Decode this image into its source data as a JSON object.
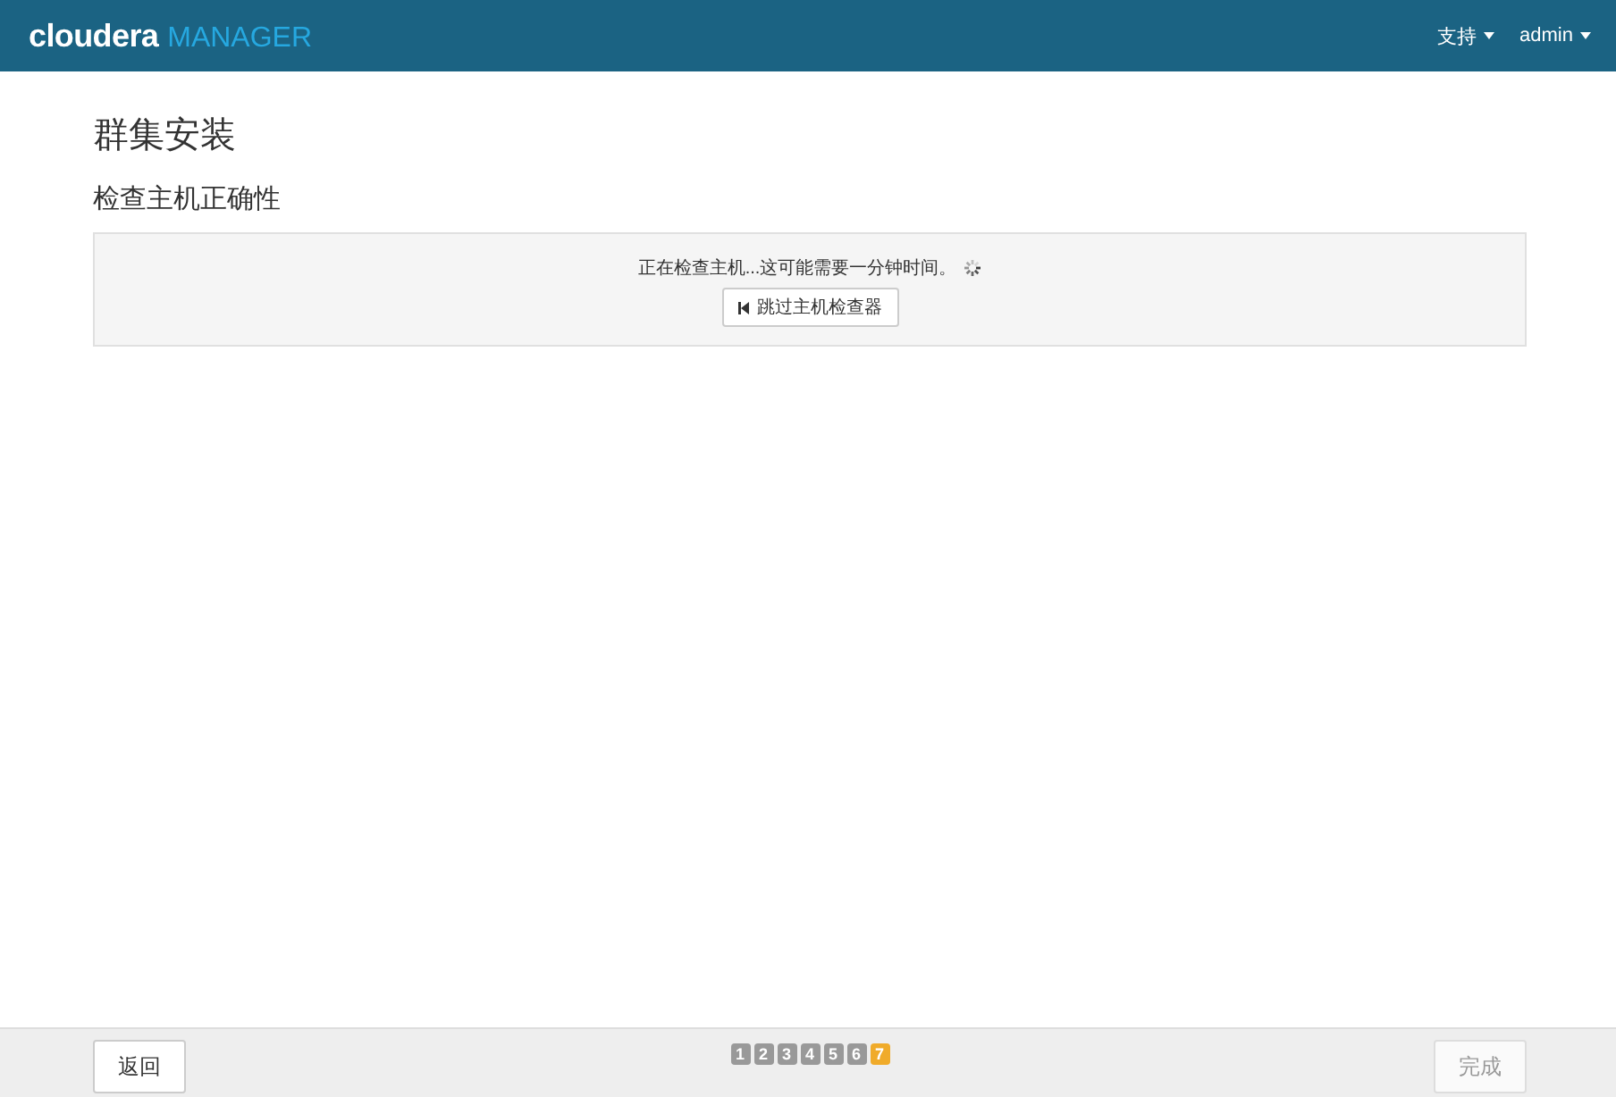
{
  "header": {
    "logo": {
      "brand": "cloudera",
      "product": "MANAGER"
    },
    "menus": [
      {
        "label": "支持"
      },
      {
        "label": "admin"
      }
    ]
  },
  "page": {
    "title": "群集安装",
    "subtitle": "检查主机正确性"
  },
  "panel": {
    "message": "正在检查主机...这可能需要一分钟时间。",
    "button": "跳过主机检查器"
  },
  "footer": {
    "back": {
      "label": "返回",
      "disabled": false
    },
    "finish": {
      "label": "完成",
      "disabled": true
    },
    "steps": [
      {
        "label": "1",
        "selected": false
      },
      {
        "label": "2",
        "selected": false
      },
      {
        "label": "3",
        "selected": false
      },
      {
        "label": "4",
        "selected": false
      },
      {
        "label": "5",
        "selected": false
      },
      {
        "label": "6",
        "selected": false
      },
      {
        "label": "7",
        "selected": true
      }
    ]
  }
}
